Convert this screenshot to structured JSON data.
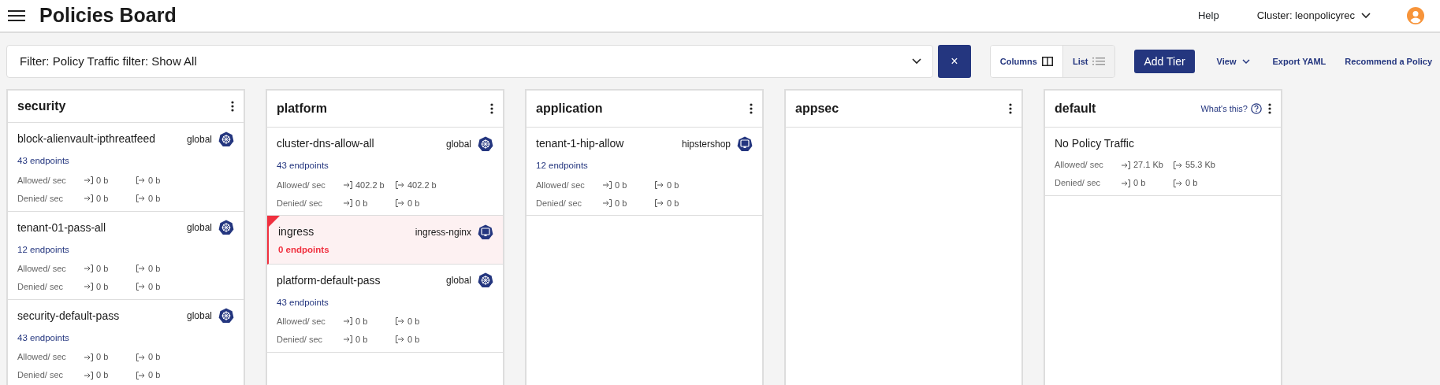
{
  "header": {
    "title": "Policies Board",
    "help": "Help",
    "cluster": "Cluster: leonpolicyrec"
  },
  "toolbar": {
    "filter": "Filter: Policy Traffic filter: Show All",
    "clear": "×",
    "views": [
      {
        "label": "Columns",
        "kind": "columns",
        "selected": true
      },
      {
        "label": "List",
        "kind": "list",
        "selected": false
      }
    ],
    "add_tier": "Add Tier",
    "view_menu": "View",
    "export": "Export YAML",
    "recommend": "Recommend a Policy"
  },
  "tiers": [
    {
      "name": "security",
      "policies": [
        {
          "name": "block-alienvault-ipthreatfeed",
          "scope": "global",
          "kind": "global",
          "endpoints": "43 endpoints",
          "warning": false,
          "traffic": [
            {
              "label": "Allowed/ sec",
              "in": "0 b",
              "out": "0 b"
            },
            {
              "label": "Denied/ sec",
              "in": "0 b",
              "out": "0 b"
            }
          ]
        },
        {
          "name": "tenant-01-pass-all",
          "scope": "global",
          "kind": "global",
          "endpoints": "12 endpoints",
          "warning": false,
          "traffic": [
            {
              "label": "Allowed/ sec",
              "in": "0 b",
              "out": "0 b"
            },
            {
              "label": "Denied/ sec",
              "in": "0 b",
              "out": "0 b"
            }
          ]
        },
        {
          "name": "security-default-pass",
          "scope": "global",
          "kind": "global",
          "endpoints": "43 endpoints",
          "warning": false,
          "traffic": [
            {
              "label": "Allowed/ sec",
              "in": "0 b",
              "out": "0 b"
            },
            {
              "label": "Denied/ sec",
              "in": "0 b",
              "out": "0 b"
            }
          ]
        }
      ]
    },
    {
      "name": "platform",
      "policies": [
        {
          "name": "cluster-dns-allow-all",
          "scope": "global",
          "kind": "global",
          "endpoints": "43 endpoints",
          "warning": false,
          "traffic": [
            {
              "label": "Allowed/ sec",
              "in": "402.2 b",
              "out": "402.2 b"
            },
            {
              "label": "Denied/ sec",
              "in": "0 b",
              "out": "0 b"
            }
          ]
        },
        {
          "name": "ingress",
          "scope": "ingress-nginx",
          "kind": "namespace",
          "endpoints": "0 endpoints",
          "warning": true
        },
        {
          "name": "platform-default-pass",
          "scope": "global",
          "kind": "global",
          "endpoints": "43 endpoints",
          "warning": false,
          "traffic": [
            {
              "label": "Allowed/ sec",
              "in": "0 b",
              "out": "0 b"
            },
            {
              "label": "Denied/ sec",
              "in": "0 b",
              "out": "0 b"
            }
          ]
        }
      ]
    },
    {
      "name": "application",
      "policies": [
        {
          "name": "tenant-1-hip-allow",
          "scope": "hipstershop",
          "kind": "namespace",
          "endpoints": "12 endpoints",
          "warning": false,
          "traffic": [
            {
              "label": "Allowed/ sec",
              "in": "0 b",
              "out": "0 b"
            },
            {
              "label": "Denied/ sec",
              "in": "0 b",
              "out": "0 b"
            }
          ]
        }
      ]
    },
    {
      "name": "appsec"
    },
    {
      "name": "default",
      "help": "What's this?",
      "policies": [
        {
          "name": "No Policy Traffic",
          "warning": false,
          "traffic": [
            {
              "label": "Allowed/ sec",
              "in": "27.1 Kb",
              "out": "55.3 Kb"
            },
            {
              "label": "Denied/ sec",
              "in": "0 b",
              "out": "0 b"
            }
          ]
        }
      ]
    }
  ]
}
